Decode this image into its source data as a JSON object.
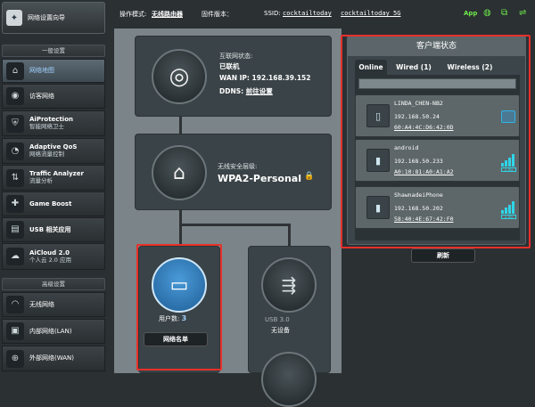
{
  "sidebar": {
    "qis": "网络设置向导",
    "general_header": "一般设置",
    "items": [
      {
        "label": "网络地图",
        "icon": "network-map-icon",
        "active": true
      },
      {
        "label": "访客网络",
        "icon": "guest-network-icon"
      },
      {
        "label": "AiProtection",
        "sub": "智能网络卫士",
        "icon": "shield-icon"
      },
      {
        "label": "Adaptive QoS",
        "sub": "网络流量控制",
        "icon": "qos-icon"
      },
      {
        "label": "Traffic Analyzer",
        "sub": "流量分析",
        "icon": "traffic-icon"
      },
      {
        "label": "Game Boost",
        "icon": "game-icon"
      },
      {
        "label": "USB 相关应用",
        "icon": "usb-app-icon"
      },
      {
        "label": "AiCloud 2.0",
        "sub": "个人云 2.0 应用",
        "icon": "cloud-icon"
      }
    ],
    "advanced_header": "高级设置",
    "adv_items": [
      {
        "label": "无线网络",
        "icon": "wireless-icon"
      },
      {
        "label": "内部网络(LAN)",
        "icon": "lan-icon"
      },
      {
        "label": "外部网络(WAN)",
        "icon": "wan-icon"
      }
    ]
  },
  "topbar": {
    "mode_label": "操作模式:",
    "mode_value": "无线路由器",
    "fw_label": "固件版本：",
    "ssid_label": "SSID:",
    "ssid1": "cocktailtoday",
    "ssid2": "cocktailtoday_5G",
    "app_label": "App",
    "colors": {
      "accent": "#6ee84a"
    }
  },
  "map": {
    "internet": {
      "status_label": "互联网状态:",
      "status": "已联机",
      "wan_ip_label": "WAN IP:",
      "wan_ip": "192.168.39.152",
      "ddns_label": "DDNS:",
      "ddns": "前往设置"
    },
    "security": {
      "label": "无线安全层级:",
      "value": "WPA2-Personal"
    },
    "clients": {
      "label": "用户数:",
      "count": "3",
      "button": "网络名单"
    },
    "usb": {
      "label": "USB 3.0",
      "status": "无设备"
    }
  },
  "client_panel": {
    "title": "客户端状态",
    "tabs": [
      "Online",
      "Wired (1)",
      "Wireless (2)"
    ],
    "clients": [
      {
        "name": "LINDA_CHEN-NB2",
        "ip": "192.168.50.24",
        "mac": "60:A4:4C:D6:42:0D",
        "conn": "wired"
      },
      {
        "name": "android",
        "ip": "192.168.50.233",
        "mac": "A0:10:81:A0:A1:A2",
        "conn": "2.4G"
      },
      {
        "name": "ShawnadeiPhone",
        "ip": "192.168.50.202",
        "mac": "58:40:4E:67:42:F0",
        "conn": "2.4G"
      }
    ],
    "refresh": "刷新"
  }
}
